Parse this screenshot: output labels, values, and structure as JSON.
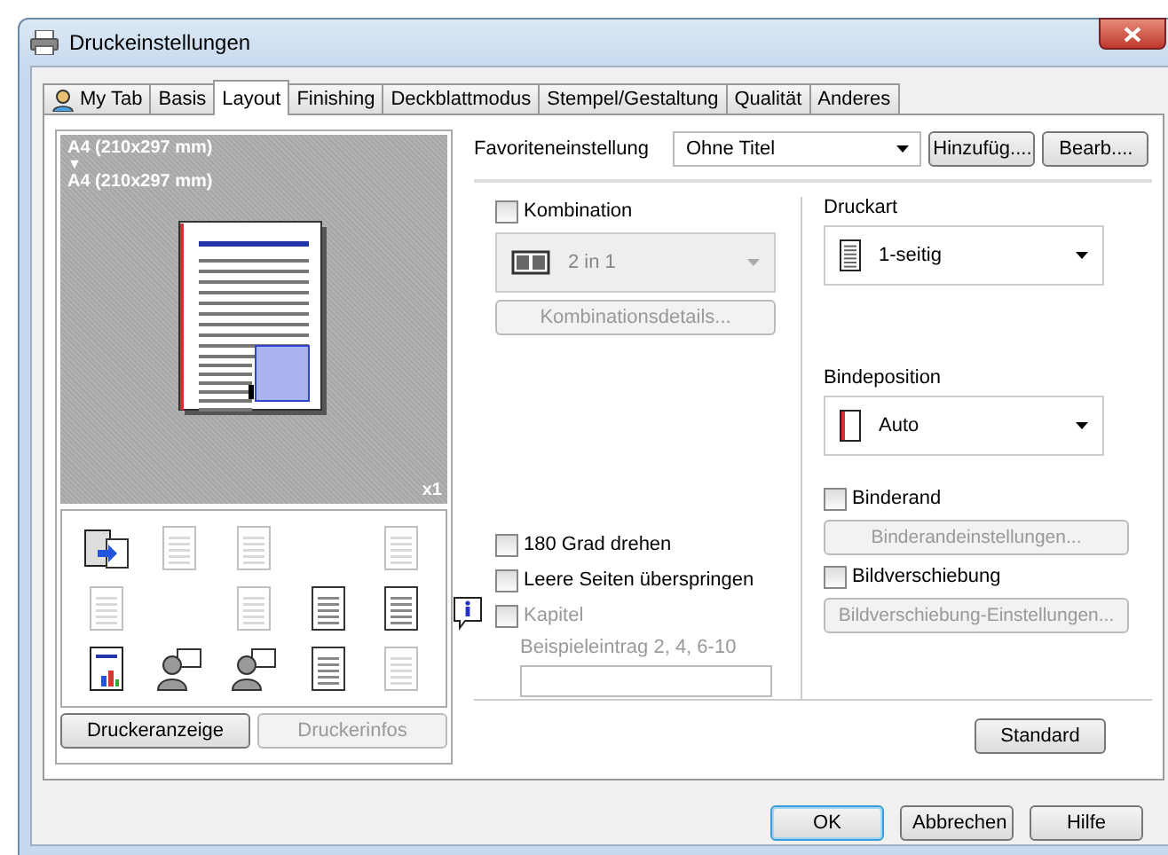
{
  "window": {
    "title": "Druckeinstellungen"
  },
  "tabs": [
    {
      "label": "My Tab",
      "selected": false,
      "kind": "person"
    },
    {
      "label": "Basis",
      "selected": false,
      "kind": "plain"
    },
    {
      "label": "Layout",
      "selected": true,
      "kind": "plain"
    },
    {
      "label": "Finishing",
      "selected": false,
      "kind": "plain"
    },
    {
      "label": "Deckblattmodus",
      "selected": false,
      "kind": "plain"
    },
    {
      "label": "Stempel/Gestaltung",
      "selected": false,
      "kind": "plain"
    },
    {
      "label": "Qualität",
      "selected": false,
      "kind": "plain"
    },
    {
      "label": "Anderes",
      "selected": false,
      "kind": "plain"
    }
  ],
  "preview": {
    "source_size": "A4 (210x297 mm)",
    "arrow": "▼",
    "output_size": "A4 (210x297 mm)",
    "copies": "x1"
  },
  "function_icons": [
    {
      "kind": "device",
      "disabled": false
    },
    {
      "kind": "document",
      "disabled": true
    },
    {
      "kind": "document",
      "disabled": true
    },
    {
      "kind": "blank"
    },
    {
      "kind": "document",
      "disabled": true
    },
    {
      "kind": "document",
      "disabled": true
    },
    {
      "kind": "blank"
    },
    {
      "kind": "document",
      "disabled": true
    },
    {
      "kind": "document",
      "disabled": false
    },
    {
      "kind": "document",
      "disabled": false
    },
    {
      "kind": "chart",
      "disabled": false
    },
    {
      "kind": "person",
      "disabled": false
    },
    {
      "kind": "person",
      "disabled": false
    },
    {
      "kind": "document",
      "disabled": false
    },
    {
      "kind": "document",
      "disabled": true
    }
  ],
  "left_buttons": [
    {
      "label": "Druckeranzeige",
      "disabled": false
    },
    {
      "label": "Druckerinfos",
      "disabled": true
    }
  ],
  "favorite": {
    "label": "Favoriteneinstellung",
    "value": "Ohne Titel",
    "buttons": [
      "Hinzufüg....",
      "Bearb...."
    ]
  },
  "combination": {
    "label": "Kombination",
    "checked": false,
    "value": "2 in 1",
    "disabled": true,
    "details_button": "Kombinationsdetails..."
  },
  "left_options": [
    {
      "label": "180 Grad drehen",
      "checked": false,
      "disabled": false
    },
    {
      "label": "Leere Seiten überspringen",
      "checked": false,
      "disabled": false
    },
    {
      "label": "Kapitel",
      "checked": false,
      "disabled": true
    }
  ],
  "chapter": {
    "hint": "Beispieleintrag 2, 4, 6-10"
  },
  "print_type": {
    "label": "Druckart",
    "value": "1-seitig"
  },
  "binding_position": {
    "label": "Bindeposition",
    "value": "Auto"
  },
  "right_options": [
    {
      "label": "Binderand",
      "checked": false,
      "button": "Binderandeinstellungen...",
      "button_disabled": true
    },
    {
      "label": "Bildverschiebung",
      "checked": false,
      "button": "Bildverschiebung-Einstellungen...",
      "button_disabled": true
    }
  ],
  "standard_button": "Standard",
  "dialog_buttons": [
    {
      "label": "OK",
      "default": true
    },
    {
      "label": "Abbrechen",
      "default": false
    },
    {
      "label": "Hilfe",
      "default": false
    }
  ]
}
